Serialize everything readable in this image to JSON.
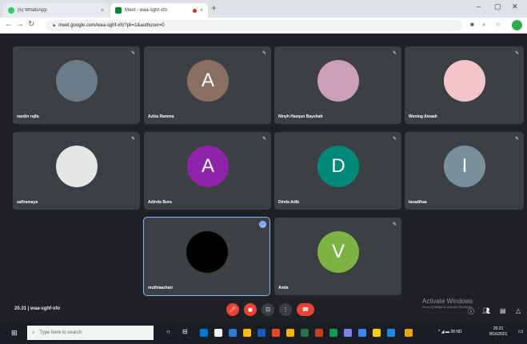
{
  "browser": {
    "tabs": [
      {
        "title": "(5) WhatsApp",
        "close": "×"
      },
      {
        "title": "Meet - waa-sghf-xfo",
        "close": "×"
      }
    ],
    "new_tab": "+",
    "window_controls": {
      "minimize": "–",
      "maximize": "▢",
      "close": "✕"
    },
    "url": "meet.google.com/waa-sghf-xfo?pli=1&authuser=0"
  },
  "participants": [
    {
      "name": "nardin rujfa",
      "avatar_letter": "",
      "avatar_color": "#6b7b88"
    },
    {
      "name": "Azkia Ramma",
      "avatar_letter": "A",
      "avatar_color": "#8d6e63"
    },
    {
      "name": "Ninyh Hazqun Bayshah",
      "avatar_letter": "",
      "avatar_color": "#c9a0b8"
    },
    {
      "name": "Wening Ainaah",
      "avatar_letter": "",
      "avatar_color": "#f3c4c9"
    },
    {
      "name": "safiramaya",
      "avatar_letter": "",
      "avatar_color": "#e6e6e6"
    },
    {
      "name": "Adinda Bora",
      "avatar_letter": "A",
      "avatar_color": "#8e24aa"
    },
    {
      "name": "Dinda Adib",
      "avatar_letter": "D",
      "avatar_color": "#00897b"
    },
    {
      "name": "lasadihaa",
      "avatar_letter": "I",
      "avatar_color": "#78909c"
    },
    {
      "name": "muthiaazhari",
      "avatar_letter": "",
      "avatar_color": "#000000"
    },
    {
      "name": "Anda",
      "avatar_letter": "V",
      "avatar_color": "#7cb342"
    }
  ],
  "controls": {
    "meeting_time": "20.31",
    "separator": "|",
    "meeting_code": "waa-sghf-xfo",
    "end_call_icon": "phone-hangup-icon"
  },
  "watermark": {
    "title": "Activate Windows",
    "subtitle": "Go to Settings to activate Windows."
  },
  "taskbar": {
    "search_placeholder": "Type here to search",
    "tray_text": "^ ◢ ▬ 28 ND",
    "time": "20.31",
    "date": "8/16/2021"
  },
  "colors": {
    "tile_bg": "#3c4043",
    "meet_bg": "#202124",
    "danger_red": "#ea4335",
    "speaking_outline": "#8ab4f8"
  }
}
